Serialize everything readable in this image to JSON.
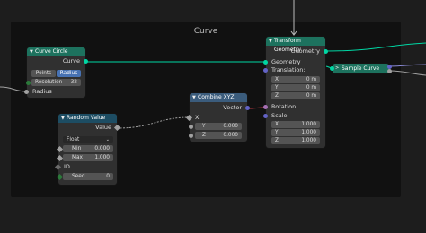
{
  "frame": {
    "title": "Curve"
  },
  "curve_circle": {
    "title": "Curve Circle",
    "output_curve": "Curve",
    "mode_points": "Points",
    "mode_radius": "Radius",
    "resolution_label": "Resolution",
    "resolution_value": "32",
    "input_radius": "Radius"
  },
  "random_value": {
    "title": "Random Value",
    "output_value": "Value",
    "type": "Float",
    "min_label": "Min",
    "min_value": "0.000",
    "max_label": "Max",
    "max_value": "1.000",
    "id_label": "ID",
    "seed_label": "Seed",
    "seed_value": "0"
  },
  "combine_xyz": {
    "title": "Combine XYZ",
    "output_vector": "Vector",
    "x_label": "X",
    "y_label": "Y",
    "y_value": "0.000",
    "z_label": "Z",
    "z_value": "0.000"
  },
  "transform_geometry": {
    "title": "Transform Geometry",
    "output_geometry": "Geometry",
    "input_geometry": "Geometry",
    "translation_label": "Translation:",
    "tx_label": "X",
    "tx_value": "0 m",
    "ty_label": "Y",
    "ty_value": "0 m",
    "tz_label": "Z",
    "tz_value": "0 m",
    "rotation_label": "Rotation",
    "scale_label": "Scale:",
    "sx_label": "X",
    "sx_value": "1.000",
    "sy_label": "Y",
    "sy_value": "1.000",
    "sz_label": "Z",
    "sz_value": "1.000"
  },
  "sample_curve": {
    "title": "Sample Curve"
  },
  "colors": {
    "geometry_header": "#1d725e",
    "vector_header": "#3b5c7c",
    "field_header": "#1d4d63",
    "geometry_socket": "#00d6a3",
    "vector_socket": "#6363c7",
    "float_socket": "#a1a1a1"
  }
}
